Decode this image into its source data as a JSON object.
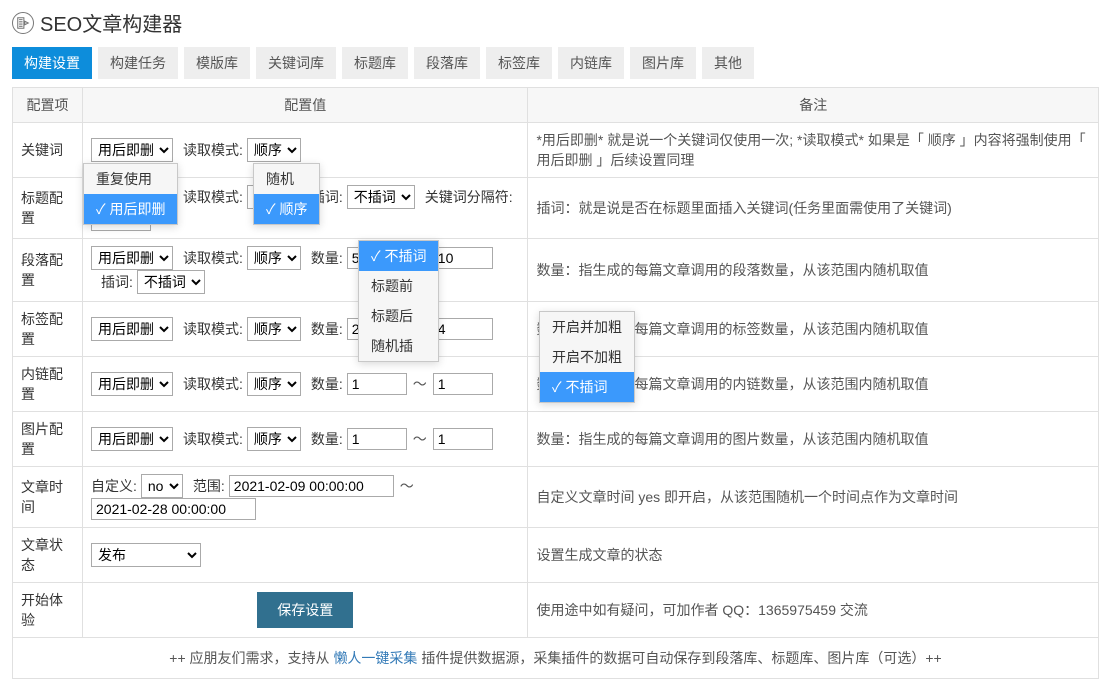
{
  "header": {
    "title": "SEO文章构建器"
  },
  "tabs": [
    "构建设置",
    "构建任务",
    "模版库",
    "关键词库",
    "标题库",
    "段落库",
    "标签库",
    "内链库",
    "图片库",
    "其他"
  ],
  "columns": {
    "c1": "配置项",
    "c2": "配置值",
    "c3": "备注"
  },
  "labels": {
    "read_mode": "读取模式:",
    "insert": "插词:",
    "keyword_sep": "关键词分隔符:",
    "count": "数量:",
    "custom": "自定义:",
    "range": "范围:",
    "tilde": "～"
  },
  "popups": {
    "a": [
      "重复使用",
      "用后即删"
    ],
    "b": [
      "随机",
      "顺序"
    ],
    "c": [
      "不插词",
      "标题前",
      "标题后",
      "随机插"
    ],
    "d": [
      "开启并加粗",
      "开启不加粗",
      "不插词"
    ]
  },
  "rows": {
    "keyword": {
      "name": "关键词",
      "mode": "用后即删",
      "read": "顺序",
      "note": "*用后即删* 就是说一个关键词仅使用一次; *读取模式* 如果是「 顺序 」内容将强制使用「 用后即删 」后续设置同理"
    },
    "title": {
      "name": "标题配置",
      "mode": "用后即删",
      "read": "顺序",
      "insert": "不插词",
      "sep": "",
      "note": "插词：就是说是否在标题里面插入关键词(任务里面需使用了关键词)"
    },
    "para": {
      "name": "段落配置",
      "mode": "用后即删",
      "read": "顺序",
      "count1": "5",
      "count2": "10",
      "insert": "不插词",
      "note": "数量：指生成的每篇文章调用的段落数量，从该范围内随机取值"
    },
    "tag": {
      "name": "标签配置",
      "mode": "用后即删",
      "read": "顺序",
      "count1": "2",
      "count2": "4",
      "note": "数量：指生成的每篇文章调用的标签数量，从该范围内随机取值"
    },
    "inlink": {
      "name": "内链配置",
      "mode": "用后即删",
      "read": "顺序",
      "count1": "1",
      "count2": "1",
      "note": "数量：指生成的每篇文章调用的内链数量，从该范围内随机取值"
    },
    "image": {
      "name": "图片配置",
      "mode": "用后即删",
      "read": "顺序",
      "count1": "1",
      "count2": "1",
      "note": "数量：指生成的每篇文章调用的图片数量，从该范围内随机取值"
    },
    "time": {
      "name": "文章时间",
      "custom": "no",
      "range1": "2021-02-09 00:00:00",
      "range2": "2021-02-28 00:00:00",
      "note": "自定义文章时间 yes 即开启，从该范围随机一个时间点作为文章时间"
    },
    "status": {
      "name": "文章状态",
      "value": "发布",
      "note": "设置生成文章的状态"
    },
    "start": {
      "name": "开始体验",
      "button": "保存设置",
      "note": "使用途中如有疑问，可加作者 QQ：1365975459 交流"
    }
  },
  "footer": {
    "pre": "++ 应朋友们需求，支持从 ",
    "link": "懒人一键采集",
    "post": " 插件提供数据源，采集插件的数据可自动保存到段落库、标题库、图片库（可选）++"
  }
}
